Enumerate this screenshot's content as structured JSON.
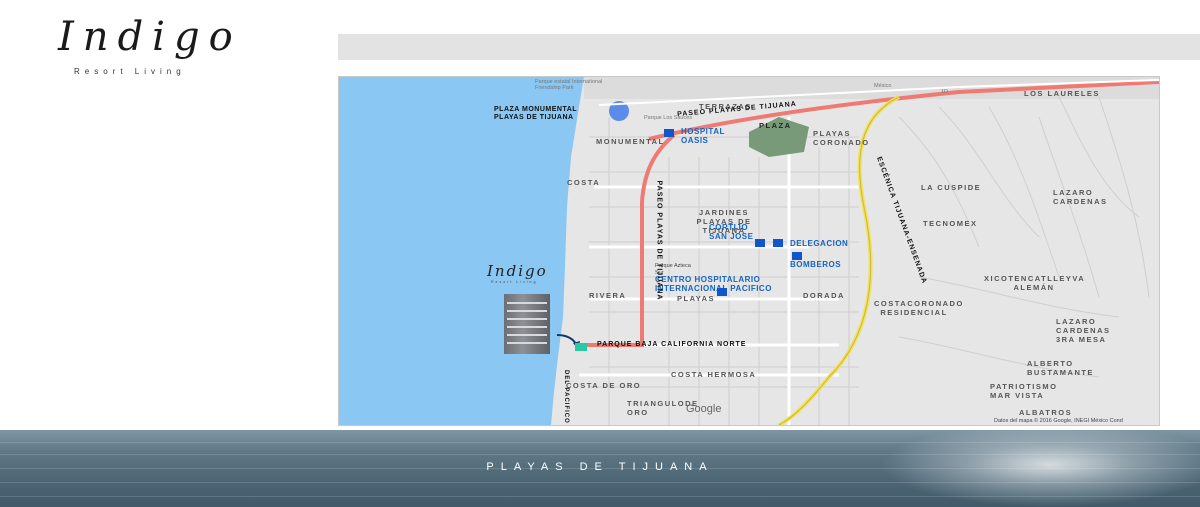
{
  "brand": {
    "name": "Indigo",
    "tagline": "Resort Living"
  },
  "map": {
    "areas": {
      "monumental": "MONUMENTAL",
      "costa": "COSTA",
      "rivera": "RIVERA",
      "costa_de_oro": "COSTA DE ORO",
      "triangulo_de_oro": "TRIANGULODE ORO",
      "jardines": "JARDINES PLAYAS DE TIJUANA",
      "playas": "PLAYAS",
      "plaza": "PLAZA",
      "playas_coronado": "PLAYAS CORONADO",
      "dorada": "DORADA",
      "costa_hermosa": "COSTA HERMOSA",
      "terrazas": "TERRAZAS",
      "los_laureles": "LOS LAURELES",
      "la_cuspide": "LA CUSPIDE",
      "lazaro_cardenas": "LAZARO CARDENAS",
      "tecnomex": "TECNOMEX",
      "xicotencatl": "XICOTENCATLLEYVA ALEMÁN",
      "costacoronado": "COSTACORONADO RESIDENCIAL",
      "lazaro_3ra": "LAZARO CARDENAS 3RA MESA",
      "alberto": "ALBERTO BUSTAMANTE",
      "patriotismo": "PATRIOTISMO MAR VISTA",
      "albatros": "ALBATROS"
    },
    "pois": {
      "plaza_monumental": "PLAZA MONUMENTAL PLAYAS DE TIJUANA",
      "hospital_oasis": "HOSPITAL OASIS",
      "cortijo": "CORTIJO SAN JOSE",
      "delegacion": "DELEGACION",
      "bomberos": "BOMBEROS",
      "centro_hospitalario": "CENTRO HOSPITALARIO INTERNACIONAL PACIFICO",
      "parque_azteca": "Parque Azteca Sur"
    },
    "roads": {
      "paseo_top": "PASEO PLAYAS DE TIJUANA",
      "paseo_vertical": "PASEO PLAYAS DE TIJUANA",
      "baja_california": "PARQUE BAJA CALIFORNIA NORTE",
      "del_pacifico": "DEL PACIFICO",
      "escenica": "ESCÉNICA TIJUANA-ENSENADA"
    },
    "small_labels": {
      "parque_estatal": "Parque estatal International Friendship Park",
      "parque_los_sauces": "Parque Los Sauces",
      "mexico": "México",
      "route_1d": "1D",
      "google": "Google",
      "copyright": "Datos del mapa © 2016 Google, INEGI    México    Cond"
    },
    "colors": {
      "ocean": "#8ac7f3",
      "land": "#e8e8e8",
      "route": "#ef7a73",
      "poi": "#1155cc",
      "highway": "#f2e15a",
      "plaza_circle": "#5b8de8",
      "plaza_park": "#789a78"
    }
  },
  "footer": {
    "caption": "PLAYAS DE TIJUANA"
  }
}
